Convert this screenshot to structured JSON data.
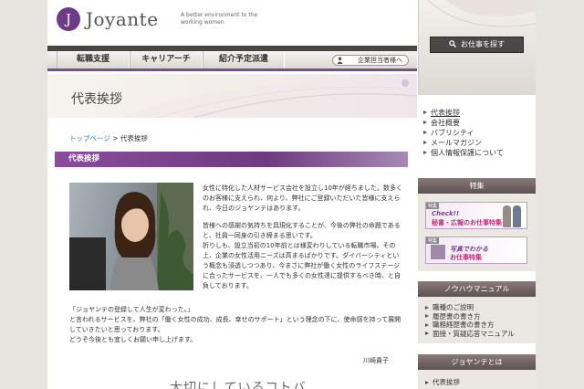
{
  "header": {
    "logo_text": "Joyante",
    "tagline": "A better environment to the working women"
  },
  "nav": {
    "items": [
      "転職支援",
      "キャリアーチ",
      "紹介予定派遣"
    ],
    "corp_button": "企業担当者様へ"
  },
  "banner": {
    "title": "代表挨拶"
  },
  "search": {
    "label": "お仕事を探す"
  },
  "sidebar": {
    "links": [
      "代表挨拶",
      "会社概要",
      "パブリシティ",
      "メールマガジン",
      "個人情報保護について"
    ],
    "special_head": "特集",
    "promos": [
      {
        "tag": "特集",
        "line1": "Check!!",
        "line2": "秘書・広報のお仕事特集"
      },
      {
        "tag": "特集",
        "line1": "写真でわかる",
        "line2": "お仕事特集"
      }
    ],
    "knowhow_head": "ノウハウマニュアル",
    "knowhow_items": [
      "職種のご説明",
      "履歴書の書き方",
      "職務経歴書の書き方",
      "面接・質疑応答マニュアル"
    ],
    "about_head": "ジョヤンテとは",
    "about_items": [
      "代表挨拶"
    ]
  },
  "breadcrumb": {
    "home": "トップページ",
    "separator": ">",
    "current": "代表挨拶"
  },
  "section": {
    "title": "代表挨拶"
  },
  "body": {
    "para1": "女性に特化した人材サービス会社を設立し10年が経ちました。数多くのお客様に支えられ、何より、弊社にご登録いただいた皆様に支えられ、今日のジョヤンテはあります。",
    "para2": "皆様への感謝の気持ちを具現化することが、今後の弊社の命題であると、社員一同身の引き締まる思いです。",
    "para3": "折りしも、設立当初の10年前とは様変わりしている転職市場。その上、企業の女性活用ニーズは高まるばかりです。ダイバーシティという概念も浸透しつつあり、今まさに弊社が働く女性のライフステージに合ったサービスを、一人でも多くの女性達に提供するべき時、と自負しております。",
    "quote1": "「ジョヤンテの登録して人生が変わった。」",
    "quote2": "と言われるサービスを、弊社の「働く女性の成功、成長、幸せのサポート」という理念の下に、使命感を持って展開していきたいと思っております。",
    "quote3": "どうぞ今後とも宜しくお願い申し上げます。",
    "signature": "川崎貴子",
    "next_heading": "大切にしているコトバ"
  },
  "colors": {
    "accent": "#7a4d8d",
    "dark": "#4a4545",
    "link": "#3a78b8"
  }
}
